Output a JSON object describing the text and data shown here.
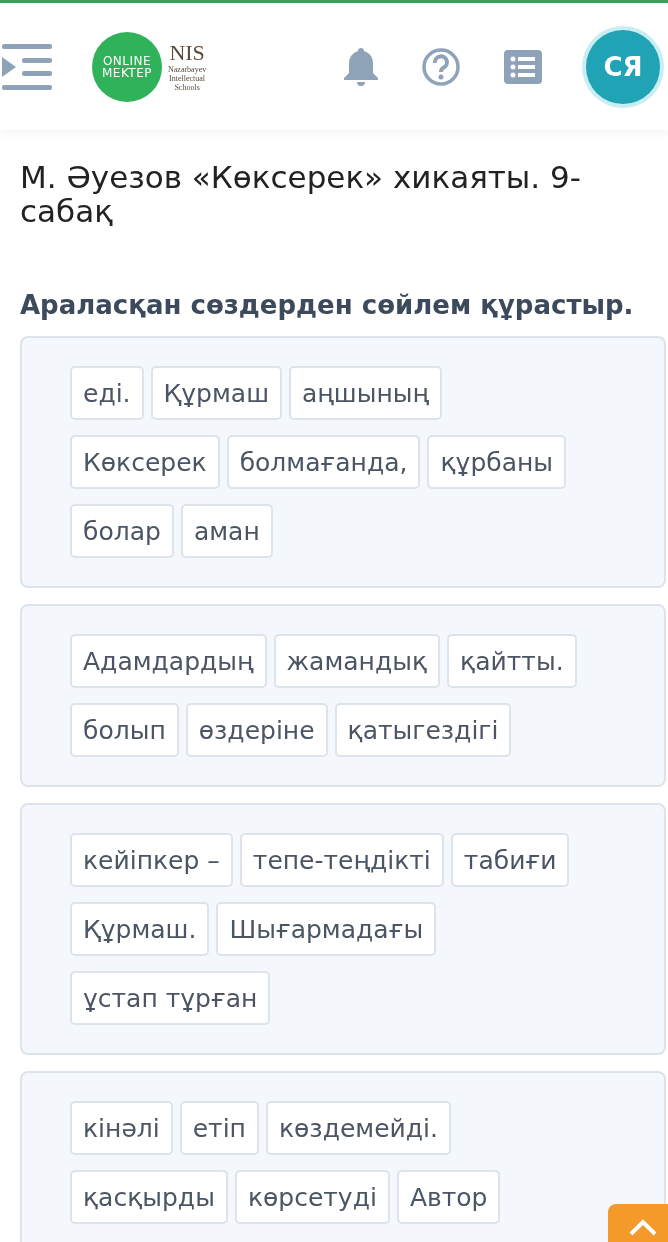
{
  "header": {
    "logo": {
      "line1": "ONLINE",
      "line2": "MEKTEP"
    },
    "partner": {
      "name": "NIS",
      "subtitle": [
        "Nazarbayev",
        "Intellectual",
        "Schools"
      ]
    },
    "avatar": "СЯ"
  },
  "title": "М. Әуезов «Көксерек» хикаяты. 9-сабақ",
  "instruction": "Араласқан сөздерден сөйлем құрастыр.",
  "cards": [
    {
      "words": [
        "еді.",
        "Құрмаш",
        "аңшының",
        "Көксерек",
        "болмағанда,",
        "құрбаны",
        "болар",
        "аман"
      ]
    },
    {
      "words": [
        "Адамдардың",
        "жамандық",
        "қайтты.",
        "болып",
        "өздеріне",
        "қатыгездігі"
      ]
    },
    {
      "words": [
        "кейіпкер –",
        "тепе-теңдікті",
        "табиғи",
        "Құрмаш.",
        "Шығармадағы",
        "ұстап тұрған"
      ]
    },
    {
      "words": [
        "кінәлі",
        "етіп",
        "көздемейді.",
        "қасқырды",
        "көрсетуді",
        "Автор"
      ]
    }
  ]
}
